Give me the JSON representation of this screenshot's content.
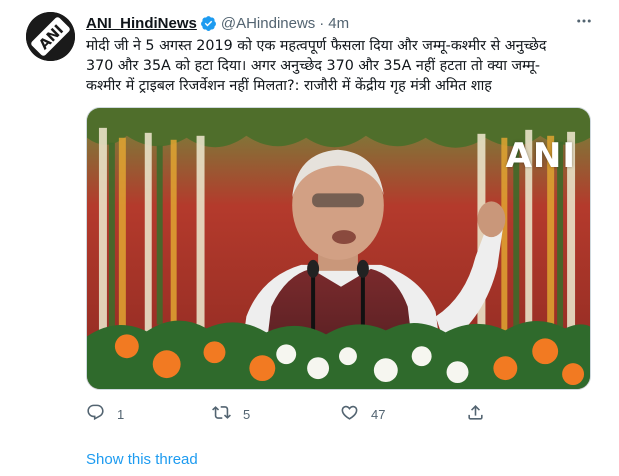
{
  "tweet": {
    "author": {
      "display_name": "ANI_HindiNews",
      "handle": "@AHindinews",
      "verified": true,
      "avatar_text": "ANI"
    },
    "separator": "·",
    "timestamp": "4m",
    "text_lines": [
      "मोदी जी ने 5 अगस्त 2019 को एक महत्वपूर्ण फैसला दिया और जम्मू-कश्मीर से अनुच्छेद",
      "370 और 35A को हटा दिया। अगर अनुच्छेद 370 और 35A नहीं हटता तो क्या जम्मू-",
      "कश्मीर में ट्राइबल रिजर्वेशन नहीं मिलता?: राजौरी में केंद्रीय गृह मंत्री अमित शाह"
    ],
    "media": {
      "watermark": "ANI"
    },
    "actions": {
      "reply_count": "1",
      "retweet_count": "5",
      "like_count": "47"
    },
    "show_thread_label": "Show this thread"
  },
  "colors": {
    "accent": "#1d9bf0",
    "secondary_text": "#536471",
    "primary_text": "#0f1419",
    "verified": "#1d9bf0"
  },
  "icons": [
    "more-icon",
    "verified-badge-icon",
    "reply-icon",
    "retweet-icon",
    "like-icon",
    "share-icon"
  ]
}
